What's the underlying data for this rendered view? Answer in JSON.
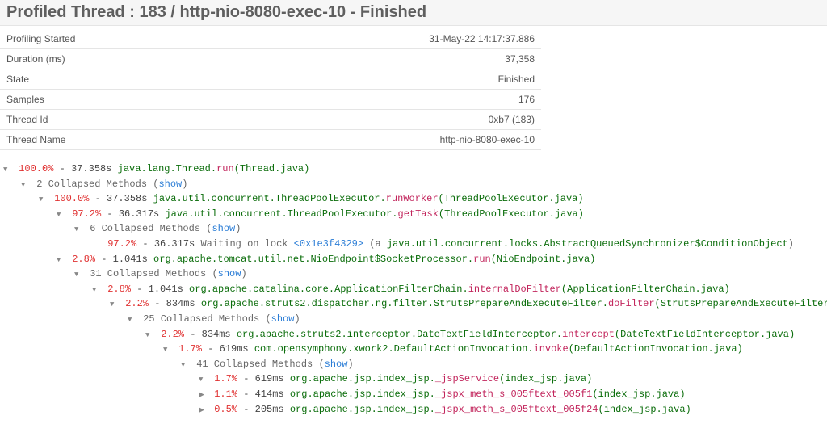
{
  "title": "Profiled Thread : 183 / http-nio-8080-exec-10 - Finished",
  "info": {
    "rows": [
      {
        "label": "Profiling Started",
        "value": "31-May-22 14:17:37.886"
      },
      {
        "label": "Duration (ms)",
        "value": "37,358"
      },
      {
        "label": "State",
        "value": "Finished"
      },
      {
        "label": "Samples",
        "value": "176"
      },
      {
        "label": "Thread Id",
        "value": "0xb7 (183)"
      },
      {
        "label": "Thread Name",
        "value": "http-nio-8080-exec-10"
      }
    ]
  },
  "show_label": "show",
  "tree": {
    "n0": {
      "pct": "100.0%",
      "time": "37.358s",
      "pkg": "java.lang.Thread.",
      "method": "run",
      "paren": "(Thread.java)"
    },
    "c0": {
      "count": "2 Collapsed Methods"
    },
    "n1": {
      "pct": "100.0%",
      "time": "37.358s",
      "pkg": "java.util.concurrent.ThreadPoolExecutor.",
      "method": "runWorker",
      "paren": "(ThreadPoolExecutor.java)"
    },
    "n2": {
      "pct": "97.2%",
      "time": "36.317s",
      "pkg": "java.util.concurrent.ThreadPoolExecutor.",
      "method": "getTask",
      "paren": "(ThreadPoolExecutor.java)"
    },
    "c2": {
      "count": "6 Collapsed Methods"
    },
    "lock": {
      "pct": "97.2%",
      "time": "36.317s",
      "text1": "Waiting on lock ",
      "id": "<0x1e3f4329>",
      "text2": " (a ",
      "cls": "java.util.concurrent.locks.AbstractQueuedSynchronizer$ConditionObject",
      "text3": ")"
    },
    "n3": {
      "pct": "2.8%",
      "time": "1.041s",
      "pkg": "org.apache.tomcat.util.net.NioEndpoint$SocketProcessor.",
      "method": "run",
      "paren": "(NioEndpoint.java)"
    },
    "c3": {
      "count": "31 Collapsed Methods"
    },
    "n4": {
      "pct": "2.8%",
      "time": "1.041s",
      "pkg": "org.apache.catalina.core.ApplicationFilterChain.",
      "method": "internalDoFilter",
      "paren": "(ApplicationFilterChain.java)"
    },
    "n5": {
      "pct": "2.2%",
      "time": "834ms",
      "pkg": "org.apache.struts2.dispatcher.ng.filter.StrutsPrepareAndExecuteFilter.",
      "method": "doFilter",
      "paren": "(StrutsPrepareAndExecuteFilter.java)"
    },
    "c5": {
      "count": "25 Collapsed Methods"
    },
    "n6": {
      "pct": "2.2%",
      "time": "834ms",
      "pkg": "org.apache.struts2.interceptor.DateTextFieldInterceptor.",
      "method": "intercept",
      "paren": "(DateTextFieldInterceptor.java)"
    },
    "n7": {
      "pct": "1.7%",
      "time": "619ms",
      "pkg": "com.opensymphony.xwork2.DefaultActionInvocation.",
      "method": "invoke",
      "paren": "(DefaultActionInvocation.java)"
    },
    "c7": {
      "count": "41 Collapsed Methods"
    },
    "n8": {
      "pct": "1.7%",
      "time": "619ms",
      "pkg": "org.apache.jsp.index_jsp.",
      "method": "_jspService",
      "paren": "(index_jsp.java)"
    },
    "n9": {
      "pct": "1.1%",
      "time": "414ms",
      "pkg": "org.apache.jsp.index_jsp.",
      "method": "_jspx_meth_s_005ftext_005f1",
      "paren": "(index_jsp.java)"
    },
    "n10": {
      "pct": "0.5%",
      "time": "205ms",
      "pkg": "org.apache.jsp.index_jsp.",
      "method": "_jspx_meth_s_005ftext_005f24",
      "paren": "(index_jsp.java)"
    }
  }
}
